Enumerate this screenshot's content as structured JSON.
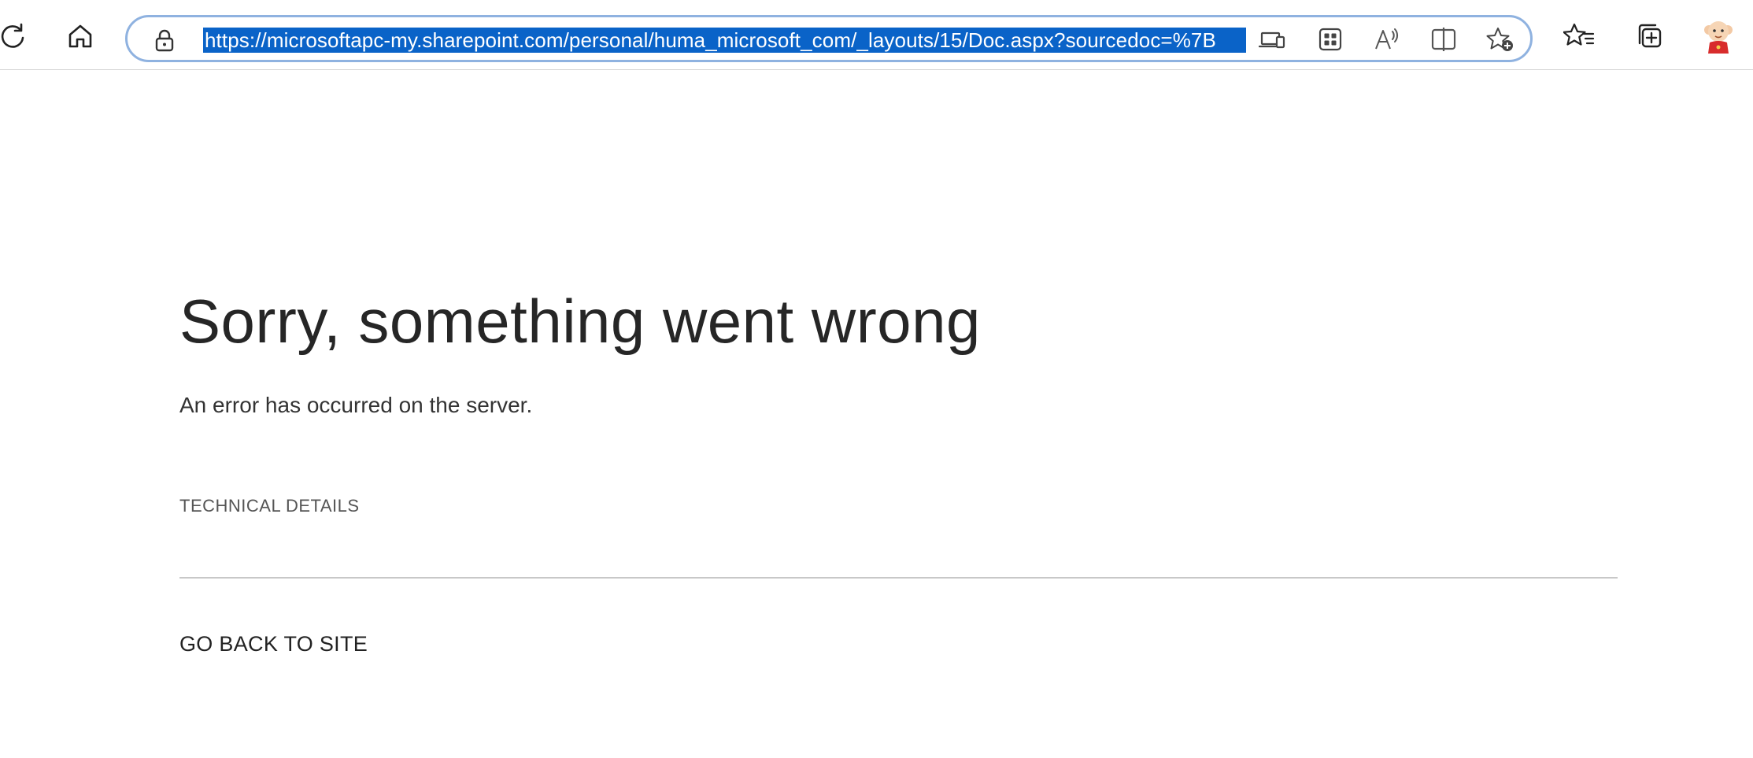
{
  "browser": {
    "address_bar": {
      "url": "https://microsoftapc-my.sharepoint.com/personal/huma_microsoft_com/_layouts/15/Doc.aspx?sourcedoc=%7B"
    },
    "toolbar_icons": [
      "refresh-icon",
      "home-icon",
      "lock-icon",
      "app-available-icon",
      "extensions-icon",
      "read-aloud-icon",
      "split-screen-icon",
      "add-favorite-icon",
      "favorites-icon",
      "collections-icon",
      "profile-avatar"
    ],
    "colors": {
      "selection": "#0a63c8",
      "address_border": "#8fb2e0"
    }
  },
  "page": {
    "title": "Sorry, something went wrong",
    "message": "An error has occurred on the server.",
    "technical_details_label": "TECHNICAL DETAILS",
    "go_back_label": "GO BACK TO SITE"
  }
}
